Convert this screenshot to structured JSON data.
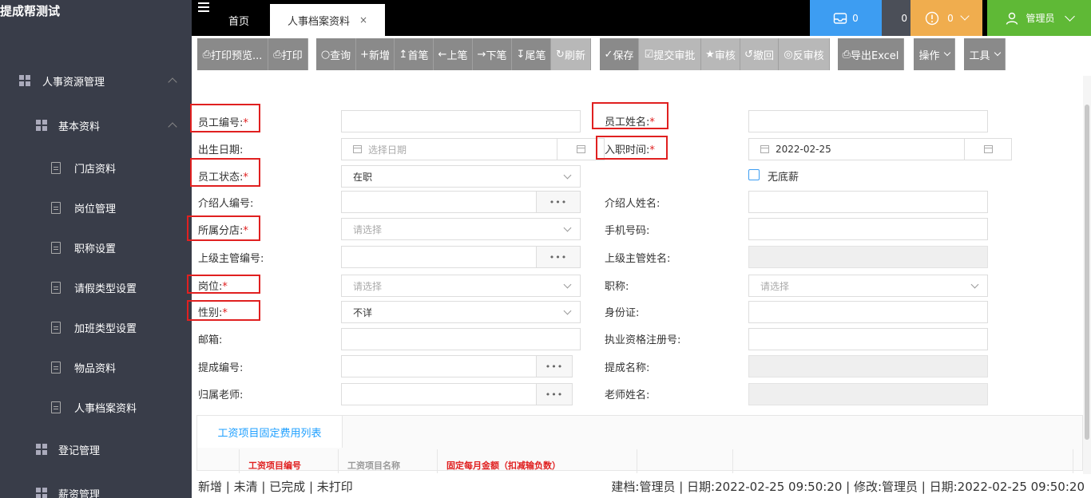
{
  "app": {
    "brand": "提成帮测试"
  },
  "sidebar": {
    "groups": [
      {
        "label": "人事资源管理"
      },
      {
        "label": "基本资料"
      },
      {
        "label": "登记管理"
      },
      {
        "label": "薪资管理"
      }
    ],
    "items": [
      {
        "label": "门店资料"
      },
      {
        "label": "岗位管理"
      },
      {
        "label": "职称设置"
      },
      {
        "label": "请假类型设置"
      },
      {
        "label": "加班类型设置"
      },
      {
        "label": "物品资料"
      },
      {
        "label": "人事档案资料"
      }
    ]
  },
  "tabs": {
    "home": "首页",
    "active": "人事档案资料",
    "close": "×"
  },
  "topbar": {
    "inbox_count": "0",
    "mail_count": "0",
    "alert_count": "0",
    "user": "管理员"
  },
  "toolbar": {
    "print_preview": "打印预览...",
    "print": "打印",
    "query": "查询",
    "add": "新增",
    "first": "首笔",
    "prev": "上笔",
    "next": "下笔",
    "last": "尾笔",
    "refresh": "刷新",
    "save": "保存",
    "submit": "提交审批",
    "audit": "审核",
    "revoke": "撤回",
    "unaudit": "反审核",
    "export": "导出Excel",
    "operate": "操作",
    "tools": "工具"
  },
  "form": {
    "emp_no": "员工编号:",
    "emp_name": "员工姓名:",
    "birth": "出生日期:",
    "birth_ph": "选择日期",
    "join_date": "入职时间:",
    "join_value": "2022-02-25",
    "status": "员工状态:",
    "status_value": "在职",
    "no_base": "无底薪",
    "ref_no": "介绍人编号:",
    "ref_name": "介绍人姓名:",
    "branch": "所属分店:",
    "select_ph": "请选择",
    "phone": "手机号码:",
    "sup_no": "上级主管编号:",
    "sup_name": "上级主管姓名:",
    "post": "岗位:",
    "title": "职称:",
    "gender": "性别:",
    "gender_value": "不详",
    "idcard": "身份证:",
    "email": "邮箱:",
    "license": "执业资格注册号:",
    "comm_no": "提成编号:",
    "comm_name": "提成名称:",
    "teacher": "归属老师:",
    "teacher_name": "老师姓名:",
    "req": "*",
    "dots": "•••"
  },
  "panel": {
    "tab": "工资项目固定费用列表",
    "col1": "工资项目编号",
    "col2": "工资项目名称",
    "col3": "固定每月金额（扣减输负数）"
  },
  "status": {
    "left": "新增 | 未清 | 已完成 | 未打印",
    "right": "建档:管理员 | 日期:2022-02-25 09:50:20 | 修改:管理员 | 日期:2022-02-25 09:50:20"
  }
}
